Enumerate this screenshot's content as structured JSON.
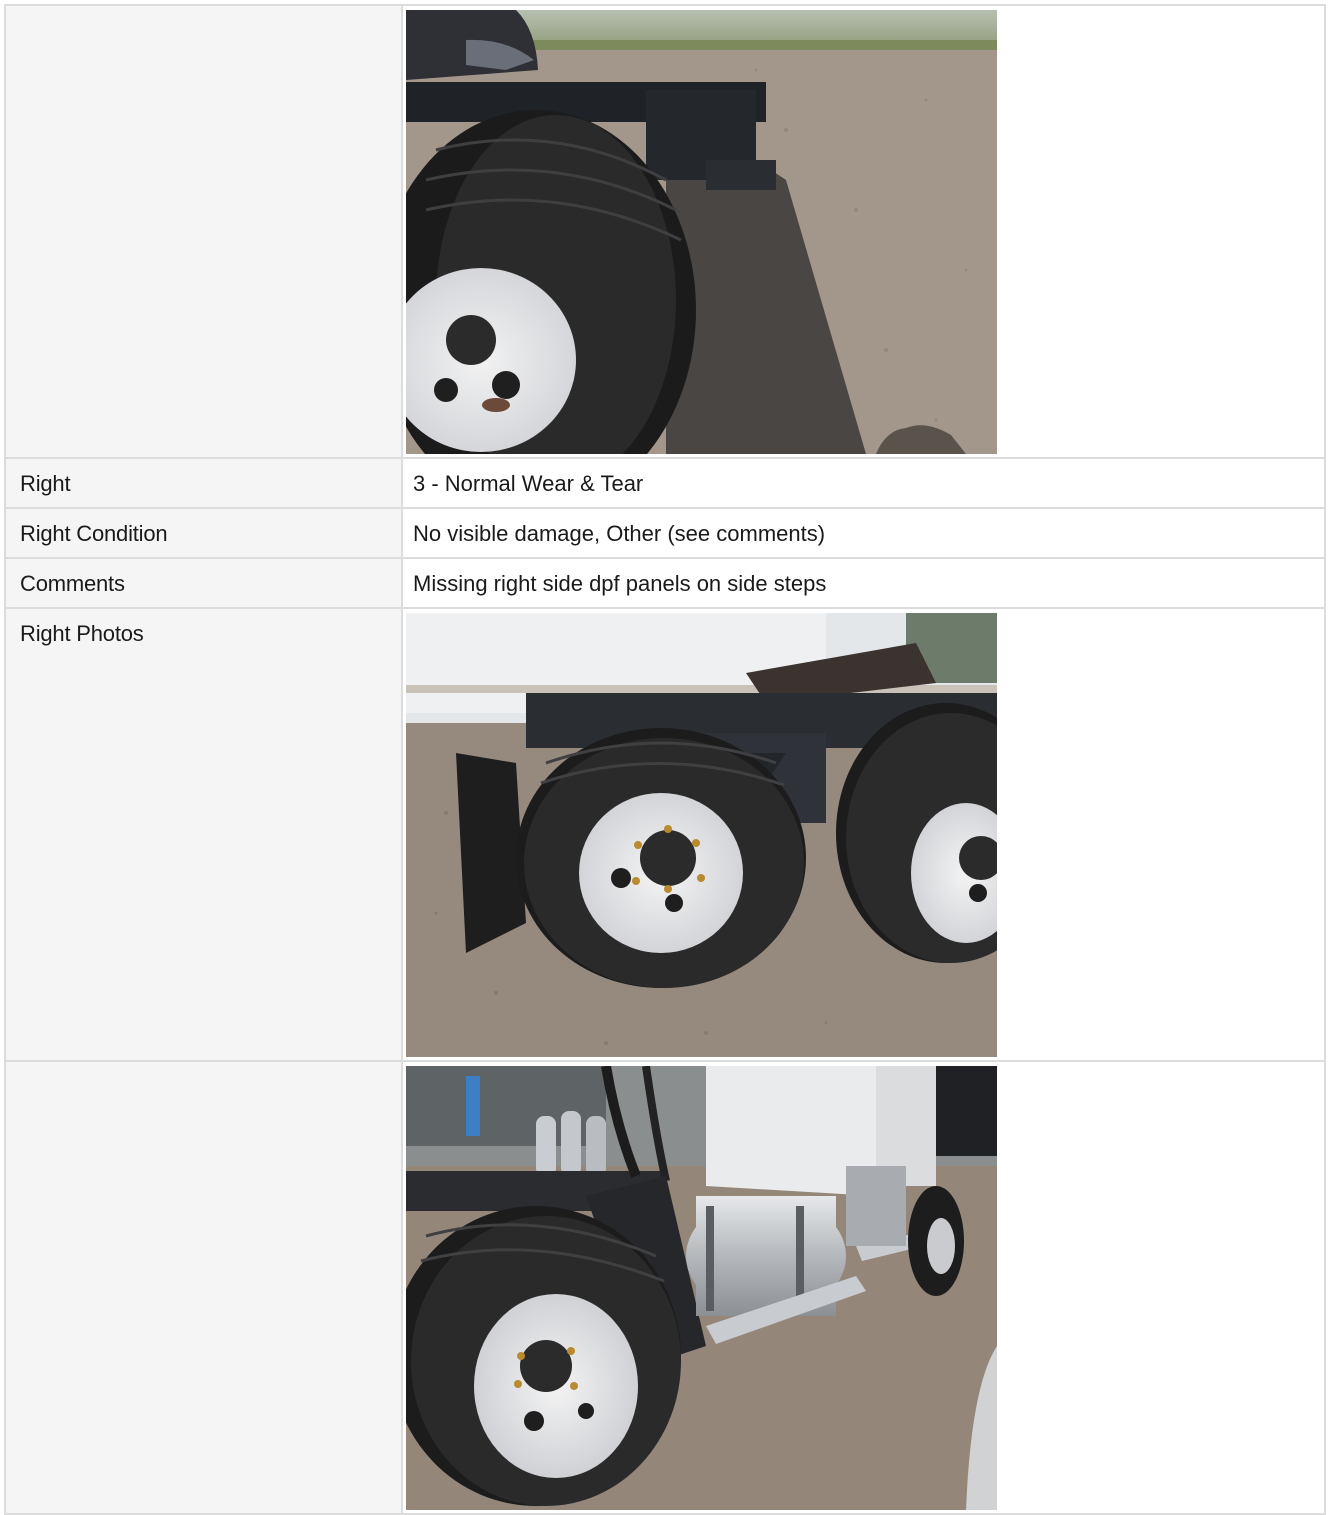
{
  "rows": [
    {
      "label": "",
      "type": "photo"
    },
    {
      "label": "Right",
      "value": "3 - Normal Wear & Tear"
    },
    {
      "label": "Right Condition",
      "value": "No visible damage, Other (see comments)"
    },
    {
      "label": "Comments",
      "value": "Missing right side dpf panels on side steps"
    },
    {
      "label": "Right Photos",
      "type": "photo"
    },
    {
      "label": "",
      "type": "photo"
    }
  ],
  "photos": [
    {
      "subject": "rear-dual-tires-frame-photo"
    },
    {
      "subject": "right-tandem-tires-mudflap-photo"
    },
    {
      "subject": "right-side-fuel-tank-steps-photo"
    }
  ]
}
